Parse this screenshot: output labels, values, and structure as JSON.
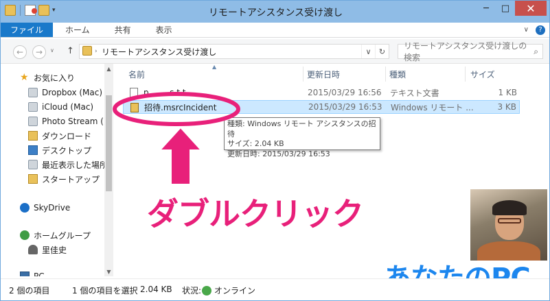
{
  "window": {
    "title": "リモートアシスタンス受け渡し",
    "minimize": "─",
    "maximize": "□",
    "close": "✕"
  },
  "ribbon": {
    "tabs": [
      "ファイル",
      "ホーム",
      "共有",
      "表示"
    ],
    "expand_icon": "chevron-down-icon",
    "help_icon": "?"
  },
  "address": {
    "back": "←",
    "forward": "→",
    "up": "↑",
    "path": "リモートアシスタンス受け渡し",
    "dropdown": "∨",
    "refresh": "↻",
    "search_placeholder": "リモートアシスタンス受け渡しの検索",
    "search_icon": "search-icon"
  },
  "nav": {
    "favorites": "お気に入り",
    "items": [
      "Dropbox (Mac)",
      "iCloud (Mac)",
      "Photo Stream (",
      "ダウンロード",
      "デスクトップ",
      "最近表示した場所",
      "スタートアップ"
    ],
    "skydrive": "SkyDrive",
    "homegroup": "ホームグループ",
    "user": "里佳史",
    "pc": "PC"
  },
  "columns": {
    "name": "名前",
    "date": "更新日時",
    "type": "種類",
    "size": "サイズ"
  },
  "files": [
    {
      "name": "p........s.t.t",
      "date": "2015/03/29 16:56",
      "type": "テキスト文書",
      "size": "1 KB"
    },
    {
      "name": "招待.msrcIncident",
      "date": "2015/03/29 16:53",
      "type": "Windows リモート ...",
      "size": "3 KB"
    }
  ],
  "tooltip": {
    "line1": "種類: Windows リモート アシスタンスの招待",
    "line2": "サイズ: 2.04 KB",
    "line3": "更新日時: 2015/03/29 16:53"
  },
  "annotation": {
    "label": "ダブルクリック",
    "color": "#e8207a"
  },
  "brand": "あなたのPC",
  "status": {
    "items": "2 個の項目",
    "selected": "1 個の項目を選択",
    "size": "2.04 KB",
    "state_label": "状況:",
    "state": "オンライン"
  }
}
